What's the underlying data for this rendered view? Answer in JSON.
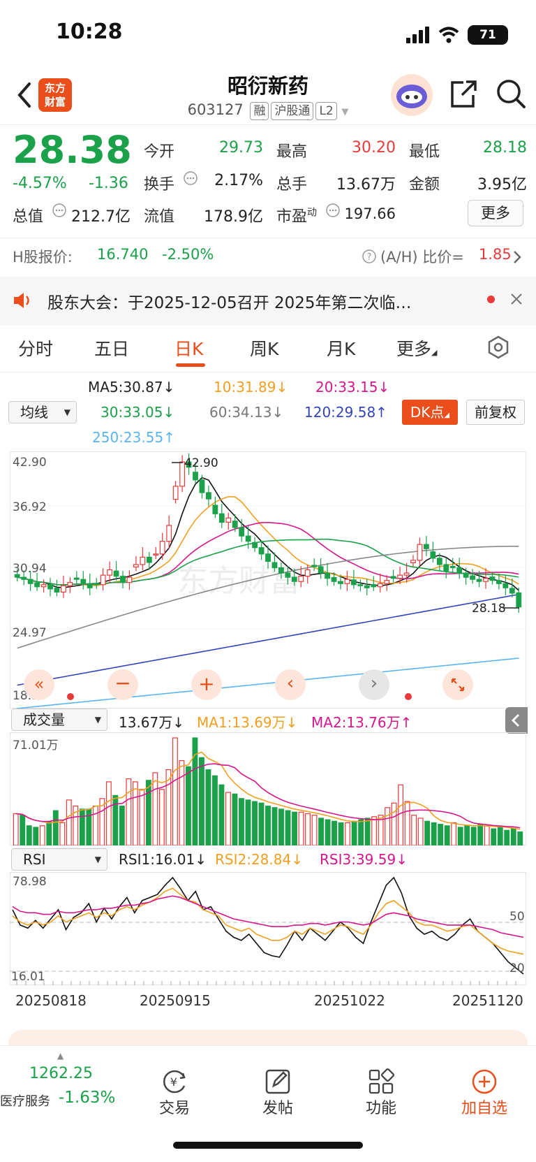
{
  "status": {
    "time": "10:28",
    "battery": "71"
  },
  "header": {
    "logo_text": "东方财富",
    "name": "昭衍新药",
    "code": "603127",
    "tags": [
      "融",
      "沪股通",
      "L2"
    ]
  },
  "quote": {
    "price": "28.38",
    "change_pct": "-4.57%",
    "change": "-1.36",
    "open_label": "今开",
    "open": "29.73",
    "high_label": "最高",
    "high": "30.20",
    "low_label": "最低",
    "low": "28.18",
    "turnover_label": "换手",
    "turnover": "2.17%",
    "volume_label": "总手",
    "volume": "13.67万",
    "amount_label": "金额",
    "amount": "3.95亿",
    "mktcap_label": "总值",
    "mktcap": "212.7亿",
    "float_label": "流值",
    "float": "178.9亿",
    "pe_label": "市盈",
    "pe_sup": "动",
    "pe": "197.66",
    "more_label": "更多"
  },
  "hshare": {
    "label": "H股报价:",
    "price": "16.740",
    "pct": "-2.50%",
    "ratio_label": "(A/H) 比价=",
    "ratio": "1.85"
  },
  "notice": {
    "text": "股东大会：于2025-12-05召开 2025年第二次临…"
  },
  "tabs": [
    "分时",
    "五日",
    "日K",
    "周K",
    "月K",
    "更多"
  ],
  "active_tab": "日K",
  "ma_legend": {
    "selector": "均线",
    "ma5": "MA5:30.87↓",
    "ma10": "10:31.89↓",
    "ma20": "20:33.15↓",
    "ma30": "30:33.05↓",
    "ma60": "60:34.13↓",
    "ma120": "120:29.58↑",
    "ma250": "250:23.55↑",
    "dk_button": "DK点",
    "fq_button": "前复权"
  },
  "price_axis": [
    "42.90",
    "36.92",
    "30.94",
    "24.97",
    "18.99"
  ],
  "annotations": {
    "max": "42.90",
    "min": "28.18",
    "watermark": "东方财富"
  },
  "volume_legend": {
    "selector": "成交量",
    "value": "13.67万↓",
    "ma1": "MA1:13.69万↓",
    "ma2": "MA2:13.76万↑",
    "axis_top": "71.01万"
  },
  "rsi_legend": {
    "selector": "RSI",
    "rsi1": "RSI1:16.01↓",
    "rsi2": "RSI2:28.84↓",
    "rsi3": "RSI3:39.59↓",
    "axis_top": "78.98",
    "axis_bottom": "16.01",
    "ref50": "50",
    "ref20": "20"
  },
  "date_axis": [
    "20250818",
    "20250915",
    "20251022",
    "20251120"
  ],
  "colors": {
    "up": "#e83a3a",
    "down": "#1aa14a",
    "accent": "#e94e1b"
  },
  "bottom_nav": {
    "index_value": "1262.25",
    "index_name": "医疗服务",
    "index_pct": "-1.63%",
    "trade": "交易",
    "post": "发帖",
    "functions": "功能",
    "add_watch": "加自选"
  },
  "chart_data": [
    {
      "type": "candlestick",
      "title": "日K",
      "ylim": [
        18.99,
        42.9
      ],
      "x_ticks": [
        "20250818",
        "20250915",
        "20251022",
        "20251120"
      ],
      "annotations": {
        "max": 42.9,
        "min": 28.18
      },
      "close": [
        31.2,
        31.0,
        30.6,
        30.3,
        30.5,
        30.1,
        29.8,
        30.4,
        30.7,
        31.0,
        30.6,
        30.2,
        30.5,
        31.4,
        31.9,
        31.3,
        30.7,
        31.2,
        32.4,
        33.1,
        32.6,
        33.4,
        34.6,
        36.1,
        39.8,
        42.1,
        41.6,
        40.4,
        39.2,
        38.6,
        37.2,
        36.4,
        36.8,
        35.9,
        35.1,
        34.6,
        34.0,
        33.4,
        32.7,
        32.1,
        31.6,
        31.2,
        30.8,
        31.3,
        31.9,
        32.2,
        31.6,
        31.1,
        30.8,
        30.6,
        31.0,
        30.5,
        30.4,
        30.2,
        30.3,
        30.6,
        30.9,
        31.1,
        31.4,
        31.6,
        32.8,
        34.3,
        33.9,
        33.0,
        32.4,
        31.8,
        32.1,
        31.6,
        31.2,
        31.0,
        30.8,
        31.1,
        30.9,
        30.6,
        30.2,
        29.7,
        28.4
      ],
      "series": [
        {
          "name": "MA5",
          "value": 30.87
        },
        {
          "name": "MA10",
          "value": 31.89
        },
        {
          "name": "MA20",
          "value": 33.15
        },
        {
          "name": "MA30",
          "value": 33.05
        },
        {
          "name": "MA60",
          "value": 34.13
        },
        {
          "name": "MA120",
          "value": 29.58
        },
        {
          "name": "MA250",
          "value": 23.55
        }
      ]
    },
    {
      "type": "bar",
      "title": "成交量",
      "ylim": [
        0,
        71.01
      ],
      "values": [
        21,
        20,
        13,
        12,
        13,
        16,
        23,
        15,
        30,
        26,
        24,
        24,
        26,
        31,
        42,
        33,
        26,
        44,
        42,
        37,
        43,
        48,
        37,
        50,
        71,
        56,
        52,
        71,
        58,
        50,
        46,
        40,
        35,
        34,
        31,
        30,
        29,
        28,
        26,
        25,
        24,
        23,
        22,
        22,
        21,
        20,
        18,
        17,
        16,
        15,
        15,
        16,
        17,
        18,
        19,
        20,
        25,
        28,
        40,
        29,
        20,
        18,
        16,
        15,
        14,
        13,
        15,
        12,
        13,
        12,
        14,
        13,
        11,
        12,
        10,
        11,
        9
      ],
      "series": [
        {
          "name": "MA1",
          "value": 13.69
        },
        {
          "name": "MA2",
          "value": 13.76
        }
      ]
    },
    {
      "type": "line",
      "title": "RSI",
      "ylim": [
        16.01,
        78.98
      ],
      "series": [
        {
          "name": "RSI1",
          "values": [
            58,
            48,
            46,
            51,
            46,
            52,
            58,
            45,
            53,
            56,
            62,
            50,
            59,
            52,
            60,
            66,
            56,
            64,
            66,
            68,
            74,
            79,
            72,
            64,
            70,
            58,
            60,
            52,
            44,
            40,
            38,
            42,
            36,
            30,
            28,
            27,
            35,
            44,
            38,
            46,
            42,
            38,
            44,
            50,
            46,
            40,
            36,
            50,
            62,
            74,
            79,
            69,
            54,
            46,
            42,
            44,
            40,
            38,
            42,
            48,
            52,
            44,
            40,
            36,
            30,
            24,
            20,
            16
          ]
        },
        {
          "name": "RSI2",
          "values": [
            54,
            50,
            48,
            50,
            48,
            50,
            54,
            50,
            52,
            54,
            56,
            53,
            56,
            54,
            58,
            60,
            58,
            61,
            63,
            66,
            70,
            72,
            68,
            64,
            63,
            58,
            56,
            54,
            48,
            46,
            44,
            46,
            42,
            40,
            38,
            38,
            40,
            44,
            42,
            46,
            44,
            42,
            45,
            48,
            47,
            44,
            42,
            48,
            56,
            62,
            64,
            60,
            56,
            50,
            48,
            48,
            46,
            44,
            45,
            47,
            48,
            44,
            40,
            36,
            33,
            31,
            30,
            29
          ]
        },
        {
          "name": "RSI3",
          "values": [
            60,
            57,
            56,
            56,
            55,
            55,
            57,
            56,
            56,
            57,
            58,
            58,
            59,
            59,
            60,
            61,
            61,
            62,
            63,
            65,
            66,
            67,
            66,
            64,
            62,
            60,
            58,
            56,
            54,
            52,
            51,
            50,
            49,
            48,
            47,
            47,
            47,
            48,
            48,
            49,
            49,
            48,
            49,
            50,
            50,
            49,
            48,
            49,
            52,
            55,
            56,
            55,
            54,
            52,
            51,
            50,
            49,
            48,
            48,
            48,
            48,
            47,
            46,
            45,
            43,
            42,
            41,
            40
          ]
        }
      ]
    }
  ]
}
